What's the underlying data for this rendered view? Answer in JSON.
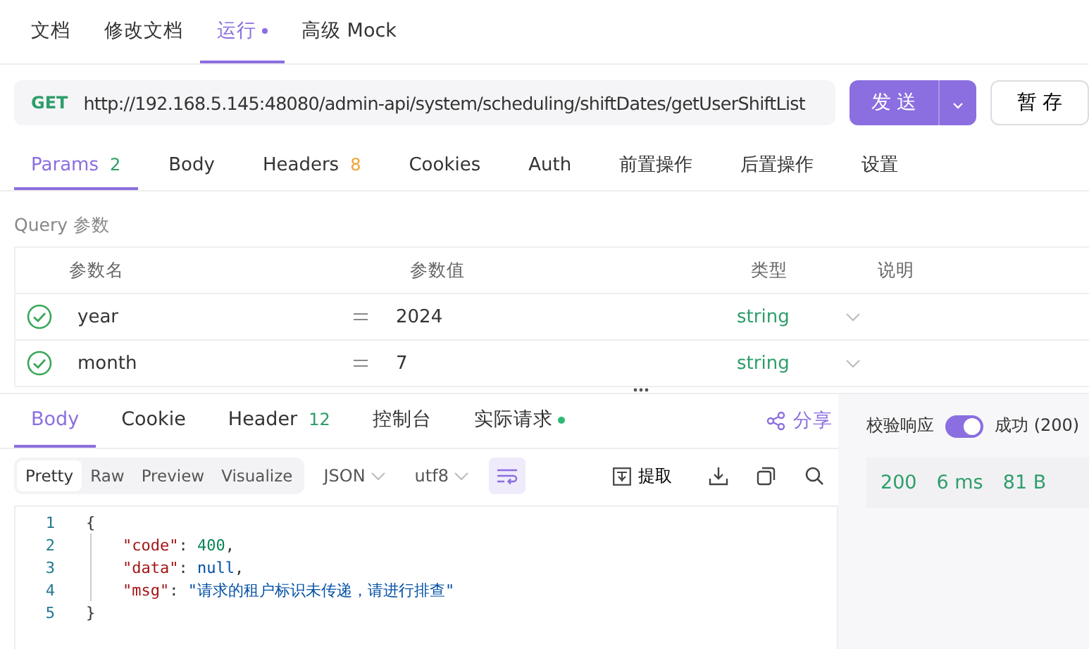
{
  "top_tabs": [
    {
      "label": "文档",
      "selected": false,
      "dot": false
    },
    {
      "label": "修改文档",
      "selected": false,
      "dot": false
    },
    {
      "label": "运行",
      "selected": true,
      "dot": true
    },
    {
      "label": "高级 Mock",
      "selected": false,
      "dot": false
    }
  ],
  "request": {
    "method": "GET",
    "url": "http://192.168.5.145:48080/admin-api/system/scheduling/shiftDates/getUserShiftList",
    "send": "发 送",
    "save": "暂 存"
  },
  "request_tabs": [
    {
      "label": "Params",
      "count": "2",
      "color": "#2e9e6a",
      "selected": true
    },
    {
      "label": "Body",
      "selected": false
    },
    {
      "label": "Headers",
      "count": "8",
      "color": "#f0a030",
      "selected": false
    },
    {
      "label": "Cookies",
      "selected": false
    },
    {
      "label": "Auth",
      "selected": false
    },
    {
      "label": "前置操作",
      "selected": false
    },
    {
      "label": "后置操作",
      "selected": false
    },
    {
      "label": "设置",
      "selected": false
    }
  ],
  "query": {
    "title": "Query 参数",
    "columns": [
      "参数名",
      "参数值",
      "类型",
      "说明"
    ],
    "rows": [
      {
        "enabled": true,
        "name": "year",
        "value": "2024",
        "type": "string"
      },
      {
        "enabled": true,
        "name": "month",
        "value": "7",
        "type": "string"
      }
    ]
  },
  "response_tabs": [
    {
      "label": "Body",
      "selected": true,
      "dot": false
    },
    {
      "label": "Cookie",
      "selected": false,
      "dot": false
    },
    {
      "label": "Header",
      "count": "12",
      "selected": false,
      "dot": false
    },
    {
      "label": "控制台",
      "selected": false,
      "dot": false
    },
    {
      "label": "实际请求",
      "selected": false,
      "dot": true
    }
  ],
  "share": "分享",
  "view_modes": [
    {
      "label": "Pretty",
      "selected": true
    },
    {
      "label": "Raw",
      "selected": false
    },
    {
      "label": "Preview",
      "selected": false
    },
    {
      "label": "Visualize",
      "selected": false
    }
  ],
  "format": "JSON",
  "encoding": "utf8",
  "extract": "提取",
  "code_lines": [
    {
      "number": "1",
      "tokens": [
        {
          "kind": "punct",
          "text": "{"
        }
      ],
      "children": [
        {
          "number": "2",
          "tokens": [
            {
              "kind": "key",
              "text": "\"code\""
            },
            {
              "kind": "punct",
              "text": ": "
            },
            {
              "kind": "number",
              "text": "400"
            },
            {
              "kind": "punct",
              "text": ","
            }
          ]
        },
        {
          "number": "3",
          "tokens": [
            {
              "kind": "key",
              "text": "\"data\""
            },
            {
              "kind": "punct",
              "text": ": "
            },
            {
              "kind": "keyword",
              "text": "null"
            },
            {
              "kind": "punct",
              "text": ","
            }
          ]
        },
        {
          "number": "4",
          "tokens": [
            {
              "kind": "key",
              "text": "\"msg\""
            },
            {
              "kind": "punct",
              "text": ": "
            },
            {
              "kind": "string",
              "text": "\"请求的租户标识未传递，请进行排查\""
            }
          ]
        }
      ]
    },
    {
      "number": "5",
      "tokens": [
        {
          "kind": "punct",
          "text": "}"
        }
      ]
    }
  ],
  "validate": {
    "label": "校验响应",
    "on": true,
    "result": "成功 (200)"
  },
  "stats": [
    "200",
    "6 ms",
    "81 B"
  ]
}
